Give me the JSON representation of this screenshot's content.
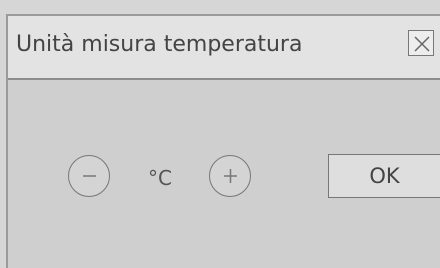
{
  "dialog": {
    "title": "Unità misura temperatura",
    "close_icon": "close-icon"
  },
  "unit_selector": {
    "decrement_icon": "minus-icon",
    "value": "°C",
    "increment_icon": "plus-icon"
  },
  "actions": {
    "ok_label": "OK"
  },
  "colors": {
    "background": "#d6d6d6",
    "titlebar": "#e3e3e3",
    "border": "#8d8d8d",
    "text": "#444444"
  }
}
